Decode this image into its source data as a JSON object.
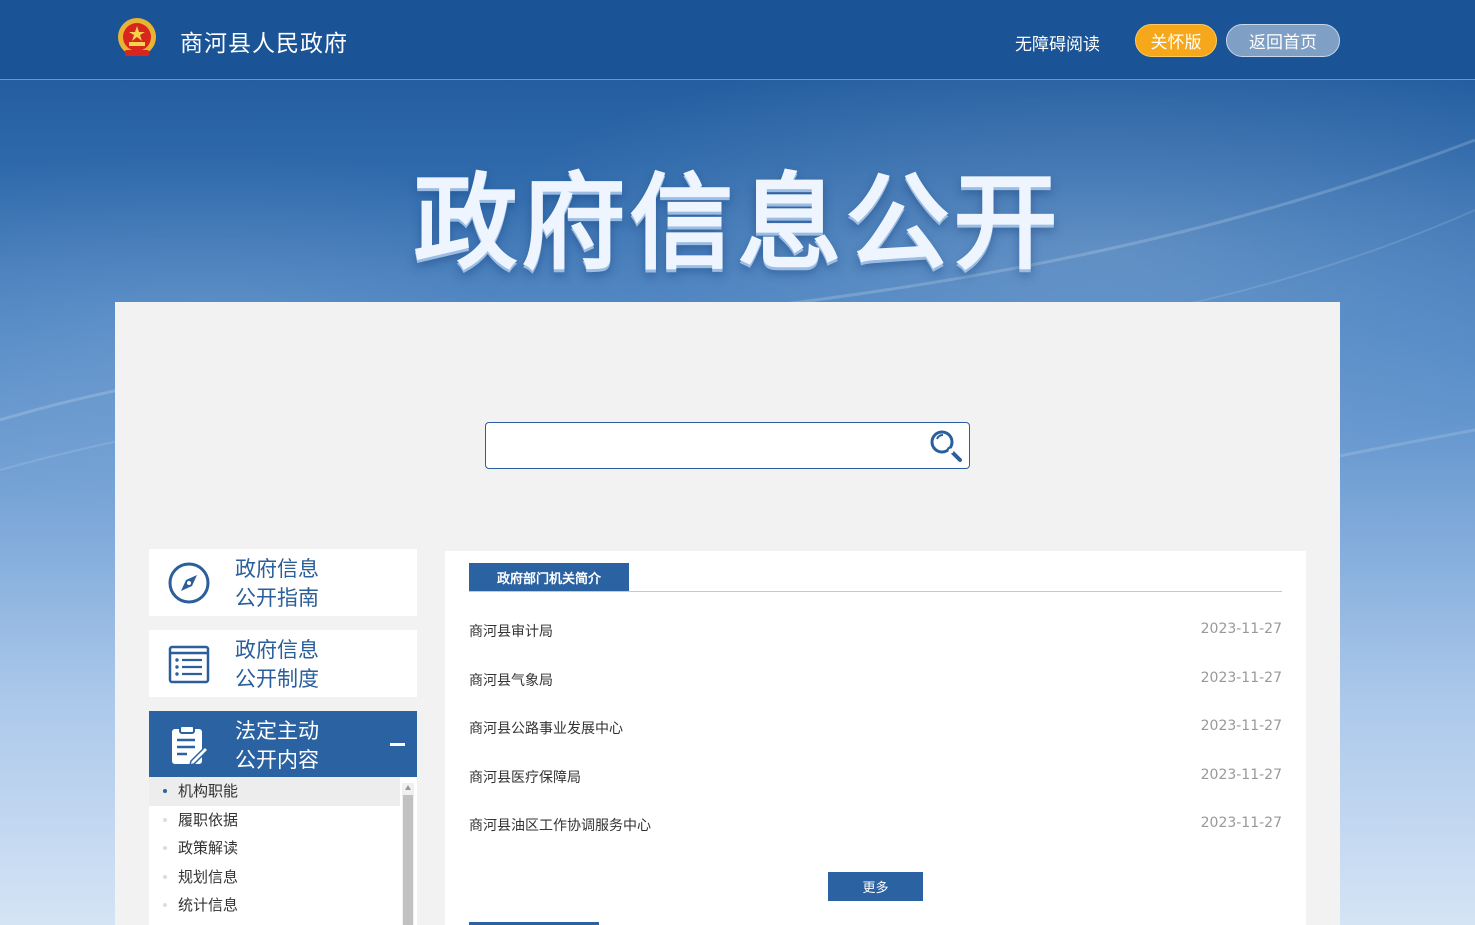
{
  "header": {
    "site_title": "商河县人民政府",
    "accessible_label": "无障碍阅读",
    "care_label": "关怀版",
    "home_label": "返回首页"
  },
  "banner": {
    "title": "政府信息公开"
  },
  "search": {
    "placeholder": "",
    "value": ""
  },
  "sidebar": {
    "cards": [
      {
        "line1": "政府信息",
        "line2": "公开指南",
        "icon": "compass-icon"
      },
      {
        "line1": "政府信息",
        "line2": "公开制度",
        "icon": "document-list-icon"
      },
      {
        "line1": "法定主动",
        "line2": "公开内容",
        "icon": "clipboard-edit-icon"
      }
    ],
    "submenu": [
      "机构职能",
      "履职依据",
      "政策解读",
      "规划信息",
      "统计信息"
    ]
  },
  "content": {
    "section_title": "政府部门机关简介",
    "items": [
      {
        "title": "商河县审计局",
        "date": "2023-11-27"
      },
      {
        "title": "商河县气象局",
        "date": "2023-11-27"
      },
      {
        "title": "商河县公路事业发展中心",
        "date": "2023-11-27"
      },
      {
        "title": "商河县医疗保障局",
        "date": "2023-11-27"
      },
      {
        "title": "商河县油区工作协调服务中心",
        "date": "2023-11-27"
      }
    ],
    "more_label": "更多"
  },
  "colors": {
    "primary": "#2b62a2",
    "header": "#1a5496",
    "care_button": "#f7a71a"
  }
}
